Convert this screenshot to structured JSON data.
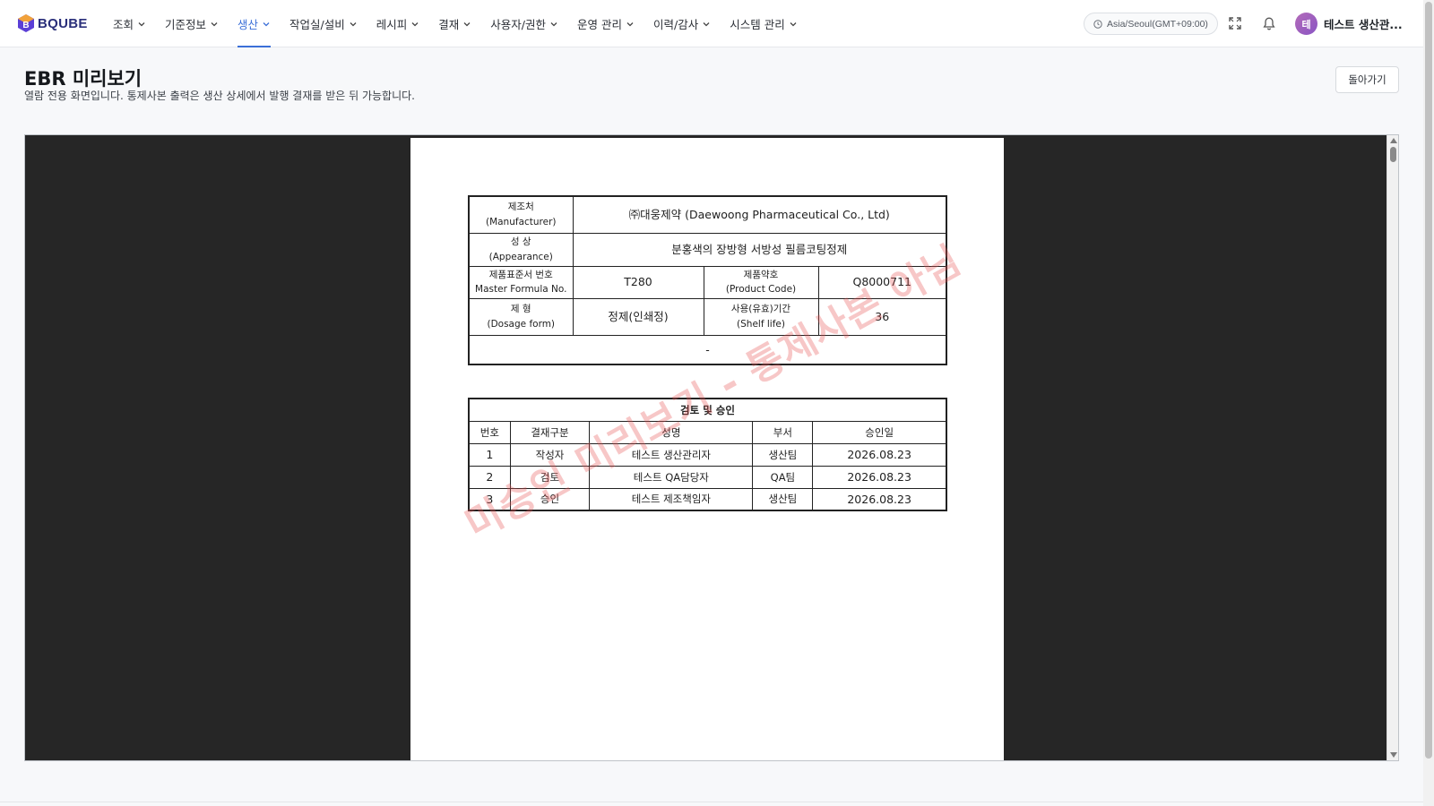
{
  "header": {
    "brand": "BQUBE",
    "nav": [
      {
        "label": "조회",
        "active": false
      },
      {
        "label": "기준정보",
        "active": false
      },
      {
        "label": "생산",
        "active": true
      },
      {
        "label": "작업실/설비",
        "active": false
      },
      {
        "label": "레시피",
        "active": false
      },
      {
        "label": "결재",
        "active": false
      },
      {
        "label": "사용자/권한",
        "active": false
      },
      {
        "label": "운영 관리",
        "active": false
      },
      {
        "label": "이력/감사",
        "active": false
      },
      {
        "label": "시스템 관리",
        "active": false
      }
    ],
    "timezone": "Asia/Seoul(GMT+09:00)",
    "user_initial": "테",
    "user_name": "테스트 생산관...",
    "icons": {
      "timezone": "clock-icon",
      "fullscreen": "fullscreen-icon",
      "notifications": "bell-icon",
      "dropdown": "chevron-down-icon"
    },
    "accent_color": "#3b6fd8"
  },
  "page": {
    "title": "EBR 미리보기",
    "subtitle": "열람 전용 화면입니다. 통제사본 출력은 생산 상세에서 발행 결재를 받은 뒤 가능합니다.",
    "back_label": "돌아가기"
  },
  "document": {
    "manufacturer_label_ko": "제조처",
    "manufacturer_label_en": "(Manufacturer)",
    "manufacturer_value": "㈜대웅제약 (Daewoong Pharmaceutical Co., Ltd)",
    "appearance_label_ko": "성 상",
    "appearance_label_en": "(Appearance)",
    "appearance_value": "분홍색의 장방형 서방성 필름코팅정제",
    "master_formula_label_ko": "제품표준서 번호",
    "master_formula_label_en": "Master Formula No.",
    "master_formula_value": "T280",
    "product_code_label_ko": "제품약호",
    "product_code_label_en": "(Product Code)",
    "product_code_value": "Q8000711",
    "dosage_label_ko": "제 형",
    "dosage_label_en": "(Dosage form)",
    "dosage_value": "정제(인쇄정)",
    "shelf_label_ko": "사용(유효)기간",
    "shelf_label_en": "(Shelf life)",
    "shelf_value": "36",
    "note_value": "-",
    "approval_title": "검토 및 승인",
    "approval_headers": [
      "번호",
      "결재구분",
      "성명",
      "부서",
      "승인일"
    ],
    "approval_rows": [
      [
        "1",
        "작성자",
        "테스트 생산관리자",
        "생산팀",
        "2026.08.23"
      ],
      [
        "2",
        "검토",
        "테스트 QA담당자",
        "QA팀",
        "2026.08.23"
      ],
      [
        "3",
        "승인",
        "테스트 제조책임자",
        "생산팀",
        "2026.08.23"
      ]
    ],
    "watermark": "미승인 미리보기 - 통제사본 아님",
    "watermark_color": "#e65050"
  }
}
